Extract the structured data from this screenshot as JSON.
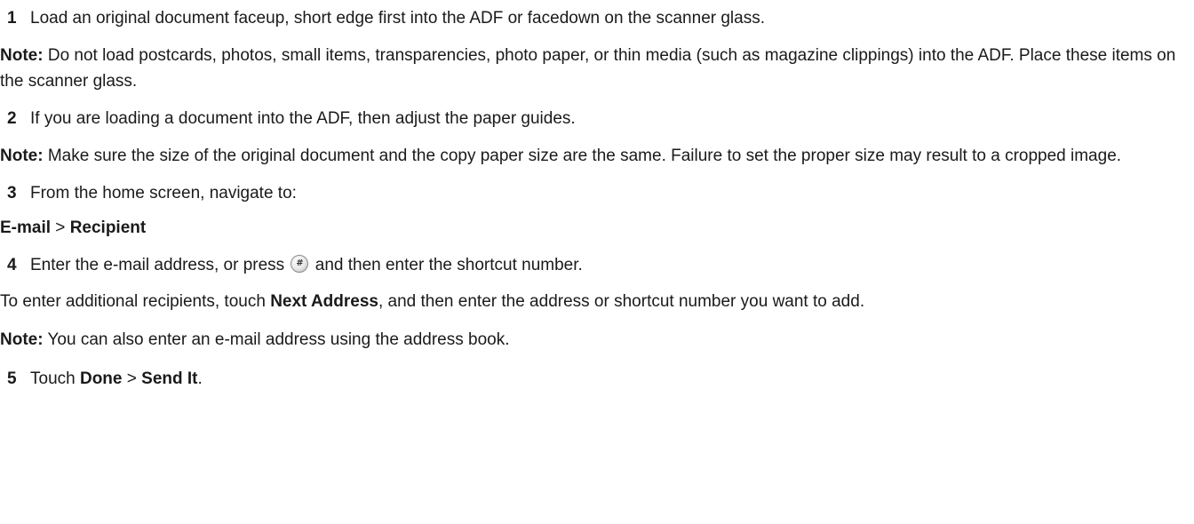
{
  "steps": {
    "s1": {
      "num": "1",
      "text": "Load an original document faceup, short edge first into the ADF or facedown on the scanner glass.",
      "note_label": "Note:",
      "note_text": " Do not load postcards, photos, small items, transparencies, photo paper, or thin media (such as magazine clippings) into the ADF. Place these items on the scanner glass."
    },
    "s2": {
      "num": "2",
      "text": "If you are loading a document into the ADF, then adjust the paper guides.",
      "note_label": "Note:",
      "note_text": " Make sure the size of the original document and the copy paper size are the same. Failure to set the proper size may result to a cropped image."
    },
    "s3": {
      "num": "3",
      "text": "From the home screen, navigate to:",
      "path_part1": "E-mail",
      "path_sep": " > ",
      "path_part2": "Recipient"
    },
    "s4": {
      "num": "4",
      "text_before_icon": "Enter the e-mail address, or press ",
      "icon": "hash-key-icon",
      "text_after_icon": " and then enter the shortcut number.",
      "extra_before": "To enter additional recipients, touch ",
      "extra_bold": "Next Address",
      "extra_after": ", and then enter the address or shortcut number you want to add.",
      "note_label": "Note:",
      "note_text": " You can also enter an e-mail address using the address book."
    },
    "s5": {
      "num": "5",
      "text_before": "Touch ",
      "bold1": "Done",
      "sep": " > ",
      "bold2": "Send It",
      "text_after": "."
    }
  }
}
